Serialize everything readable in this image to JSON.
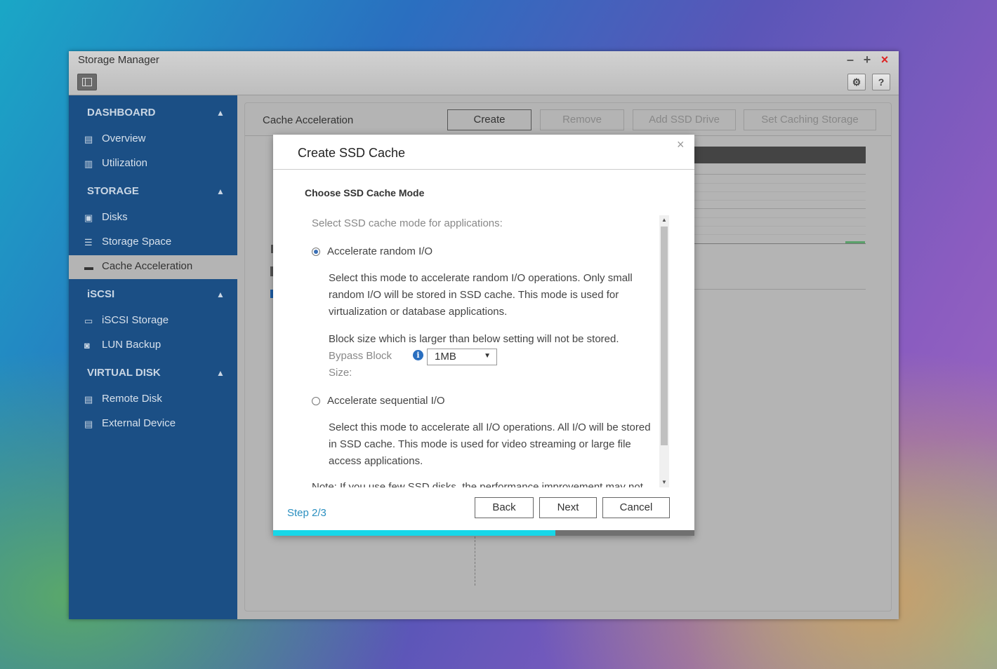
{
  "window": {
    "title": "Storage Manager",
    "controls": [
      "–",
      "+",
      "×"
    ],
    "settings_icon": "gear-icon",
    "help_label": "?"
  },
  "sidebar": {
    "sections": [
      {
        "label": "DASHBOARD",
        "items": [
          {
            "label": "Overview",
            "icon": "list-icon"
          },
          {
            "label": "Utilization",
            "icon": "bar-chart-icon"
          }
        ]
      },
      {
        "label": "STORAGE",
        "items": [
          {
            "label": "Disks",
            "icon": "disk-icon"
          },
          {
            "label": "Storage Space",
            "icon": "stack-icon"
          },
          {
            "label": "Cache Acceleration",
            "icon": "ssd-icon",
            "active": true
          }
        ]
      },
      {
        "label": "iSCSI",
        "items": [
          {
            "label": "iSCSI Storage",
            "icon": "drive-icon"
          },
          {
            "label": "LUN Backup",
            "icon": "backup-icon"
          }
        ]
      },
      {
        "label": "VIRTUAL DISK",
        "items": [
          {
            "label": "Remote Disk",
            "icon": "remote-disk-icon"
          },
          {
            "label": "External Device",
            "icon": "external-device-icon"
          }
        ]
      }
    ]
  },
  "main": {
    "title": "Cache Acceleration",
    "buttons": {
      "create": "Create",
      "remove": "Remove",
      "add_ssd": "Add SSD Drive",
      "set_caching": "Set Caching Storage"
    }
  },
  "dialog": {
    "title": "Create SSD Cache",
    "close": "×",
    "subtitle": "Choose SSD Cache Mode",
    "intro": "Select SSD cache mode for applications:",
    "option_random": {
      "label": "Accelerate random I/O",
      "selected": true,
      "desc_line1": "Select this mode to accelerate random I/O operations. Only small",
      "desc_line2": "random I/O will be stored in SSD cache. This mode is used for",
      "desc_line3": "virtualization or database applications.",
      "block_note": "Block size which is larger than below setting will not be stored.",
      "bypass_label_1": "Bypass Block",
      "bypass_label_2": "Size:",
      "bypass_value": "1MB"
    },
    "option_sequential": {
      "label": "Accelerate sequential I/O",
      "selected": false,
      "desc_line1": "Select this mode to accelerate all I/O operations. All I/O will be stored",
      "desc_line2": "in SSD cache. This mode is used for video streaming or large file",
      "desc_line3": "access applications."
    },
    "note_partial": "Note: If you use few SSD disks, the performance improvement may not",
    "step": "Step 2/3",
    "progress": 0.67,
    "buttons": {
      "back": "Back",
      "next": "Next",
      "cancel": "Cancel"
    }
  }
}
